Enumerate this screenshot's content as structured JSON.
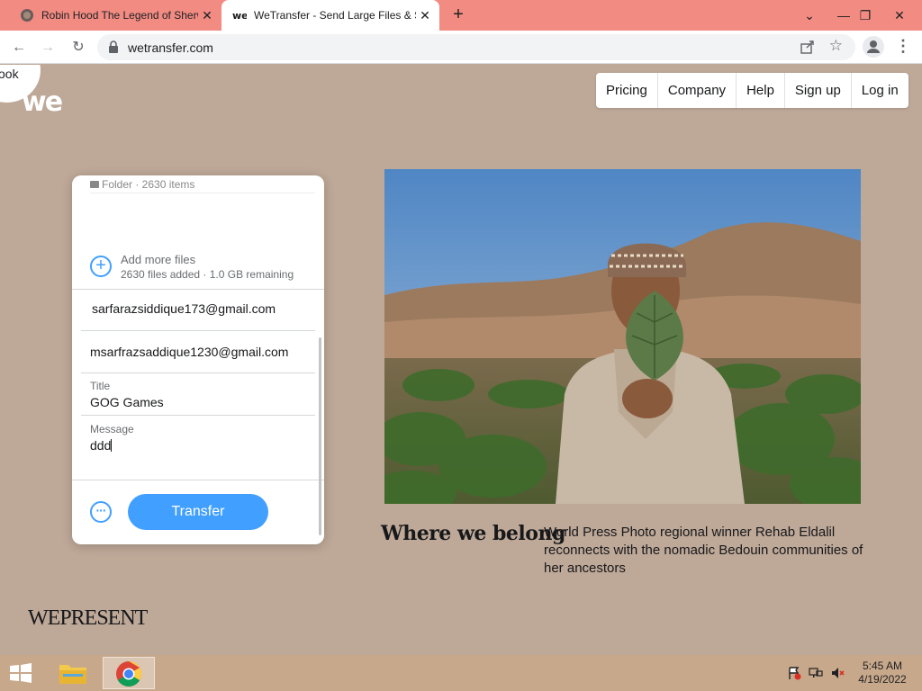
{
  "browser": {
    "tabs": [
      {
        "title": "Robin Hood The Legend of Sherwood",
        "active": false
      },
      {
        "title": "WeTransfer - Send Large Files & Share Photos Online",
        "active": true
      }
    ],
    "new_tab_label": "+",
    "url": "wetransfer.com"
  },
  "page": {
    "bubble_text": "ook",
    "logo_text": "we",
    "nav": [
      "Pricing",
      "Company",
      "Help",
      "Sign up",
      "Log in"
    ]
  },
  "panel": {
    "folder_label": "Folder · 2630 items",
    "add_more_label": "Add more files",
    "files_summary": "2630 files added · 1.0 GB remaining",
    "email_to": "sarfarazsiddique173@gmail.com",
    "email_from": "msarfrazsaddique1230@gmail.com",
    "title_label": "Title",
    "title_value": "GOG Games",
    "message_label": "Message",
    "message_value": "ddd",
    "more_options": "···",
    "transfer_label": "Transfer"
  },
  "feature": {
    "title": "Where we belong",
    "description": "World Press Photo regional winner Rehab Eldalil reconnects with the nomadic Bedouin communities of her ancestors"
  },
  "brand_footer": "WEPRESENT",
  "taskbar": {
    "time": "5:45 AM",
    "date": "4/19/2022"
  },
  "colors": {
    "page_bg": "#bea898",
    "accent": "#409fff",
    "tab_strip": "#f28b82"
  }
}
